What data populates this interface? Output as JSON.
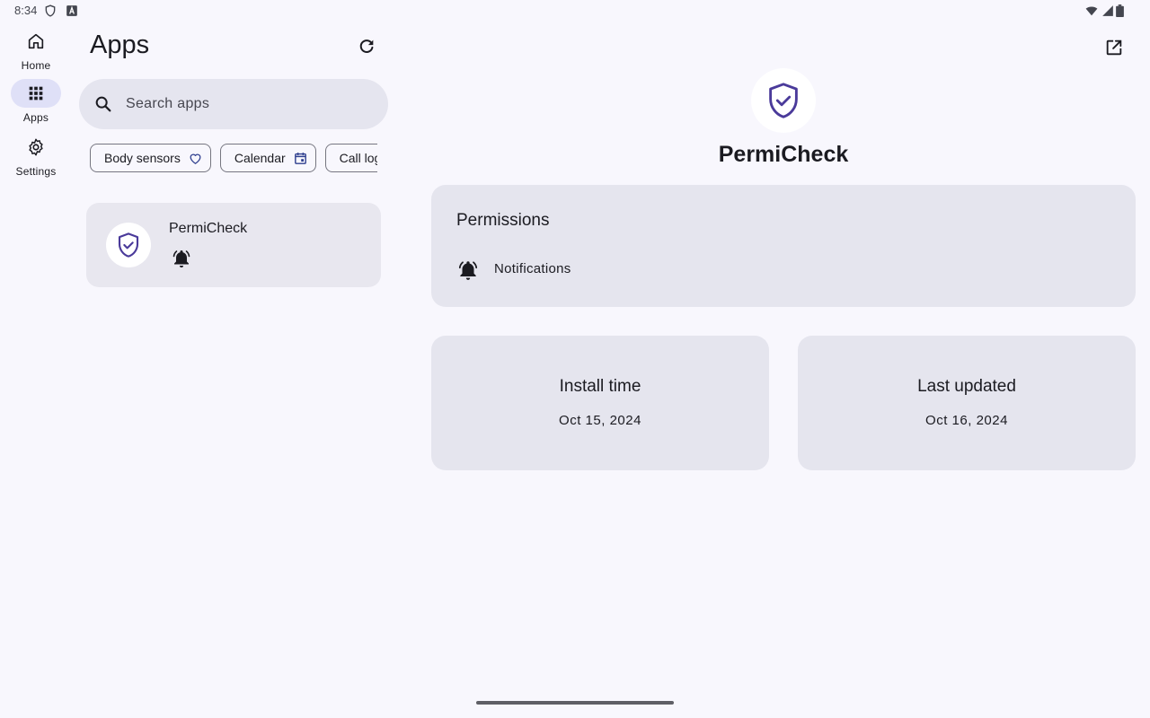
{
  "status_bar": {
    "time": "8:34",
    "left_icons": [
      "shield-icon",
      "font-icon"
    ],
    "right_icons": [
      "wifi-icon",
      "signal-icon",
      "battery-icon"
    ]
  },
  "nav_rail": {
    "items": [
      {
        "label": "Home",
        "icon": "home-icon",
        "active": false
      },
      {
        "label": "Apps",
        "icon": "apps-grid-icon",
        "active": true
      },
      {
        "label": "Settings",
        "icon": "gear-icon",
        "active": false
      }
    ]
  },
  "list_pane": {
    "title": "Apps",
    "refresh_icon": "refresh-icon",
    "search": {
      "placeholder": "Search apps",
      "value": ""
    },
    "filter_chips": [
      {
        "label": "Body sensors",
        "icon": "heart-icon"
      },
      {
        "label": "Calendar",
        "icon": "calendar-icon"
      },
      {
        "label": "Call log",
        "icon": "call-log-icon"
      }
    ],
    "apps": [
      {
        "name": "PermiCheck",
        "icon": "shield-check-icon",
        "permission_icons": [
          "bell-ringing-icon"
        ]
      }
    ]
  },
  "detail_pane": {
    "open_external_icon": "open-in-new-icon",
    "app_name": "PermiCheck",
    "permissions": {
      "title": "Permissions",
      "items": [
        {
          "label": "Notifications",
          "icon": "bell-ringing-icon"
        }
      ]
    },
    "install": {
      "title": "Install time",
      "value": "Oct 15, 2024"
    },
    "updated": {
      "title": "Last updated",
      "value": "Oct 16, 2024"
    }
  },
  "colors": {
    "background": "#f8f7fd",
    "card": "#e5e5ee",
    "active_pill": "#dfe0f7",
    "brand_shield": "#4a3a9a",
    "text": "#1b1b21"
  }
}
